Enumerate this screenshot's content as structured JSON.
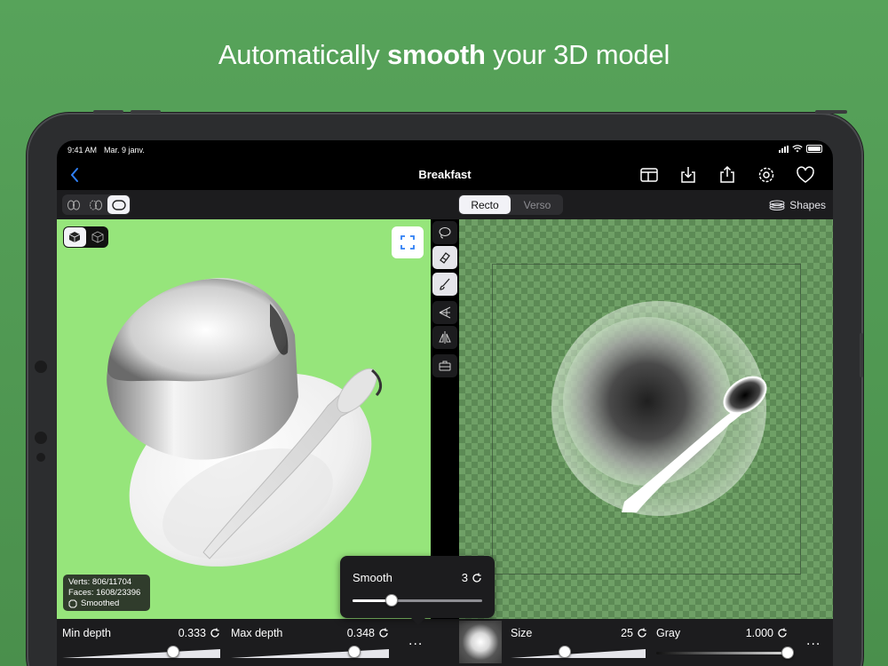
{
  "headline": {
    "prefix": "Automatically ",
    "bold": "smooth",
    "suffix": " your 3D model"
  },
  "statusbar": {
    "time": "9:41 AM",
    "date": "Mar. 9 janv."
  },
  "navbar": {
    "back_icon": "chevron-left-icon",
    "title": "Breakfast",
    "icons": [
      "layout-icon",
      "download-icon",
      "share-icon",
      "settings-icon",
      "heart-icon"
    ]
  },
  "toolbar": {
    "view_modes": [
      "mirror-front-icon",
      "mirror-back-icon",
      "single-view-icon"
    ],
    "selected_view_mode": 2,
    "side_tabs": [
      "Recto",
      "Verso"
    ],
    "selected_side": "Recto",
    "shapes_label": "Shapes"
  },
  "viewport": {
    "render_modes": [
      "solid-cube-icon",
      "wireframe-cube-icon"
    ],
    "selected_render_mode": 0,
    "stats": {
      "verts": "Verts: 806/11704",
      "faces": "Faces: 1608/23396",
      "smoothed": "Smoothed"
    },
    "background_color": "#96e57b"
  },
  "tools": [
    "lasso-icon",
    "eraser-icon",
    "brush-icon",
    "perspective-icon",
    "symmetry-icon",
    "toolbox-icon"
  ],
  "selected_tool": 1,
  "bottom": {
    "min_depth": {
      "label": "Min depth",
      "value": "0.333",
      "level": 0.7
    },
    "max_depth": {
      "label": "Max depth",
      "value": "0.348",
      "level": 0.78
    },
    "size": {
      "label": "Size",
      "value": "25",
      "level": 0.4
    },
    "gray": {
      "label": "Gray",
      "value": "1.000",
      "level": 1.0
    },
    "more_label": "..."
  },
  "smooth_popover": {
    "label": "Smooth",
    "value": "3",
    "level": 0.3
  },
  "accent_color": "#2f7ff5"
}
